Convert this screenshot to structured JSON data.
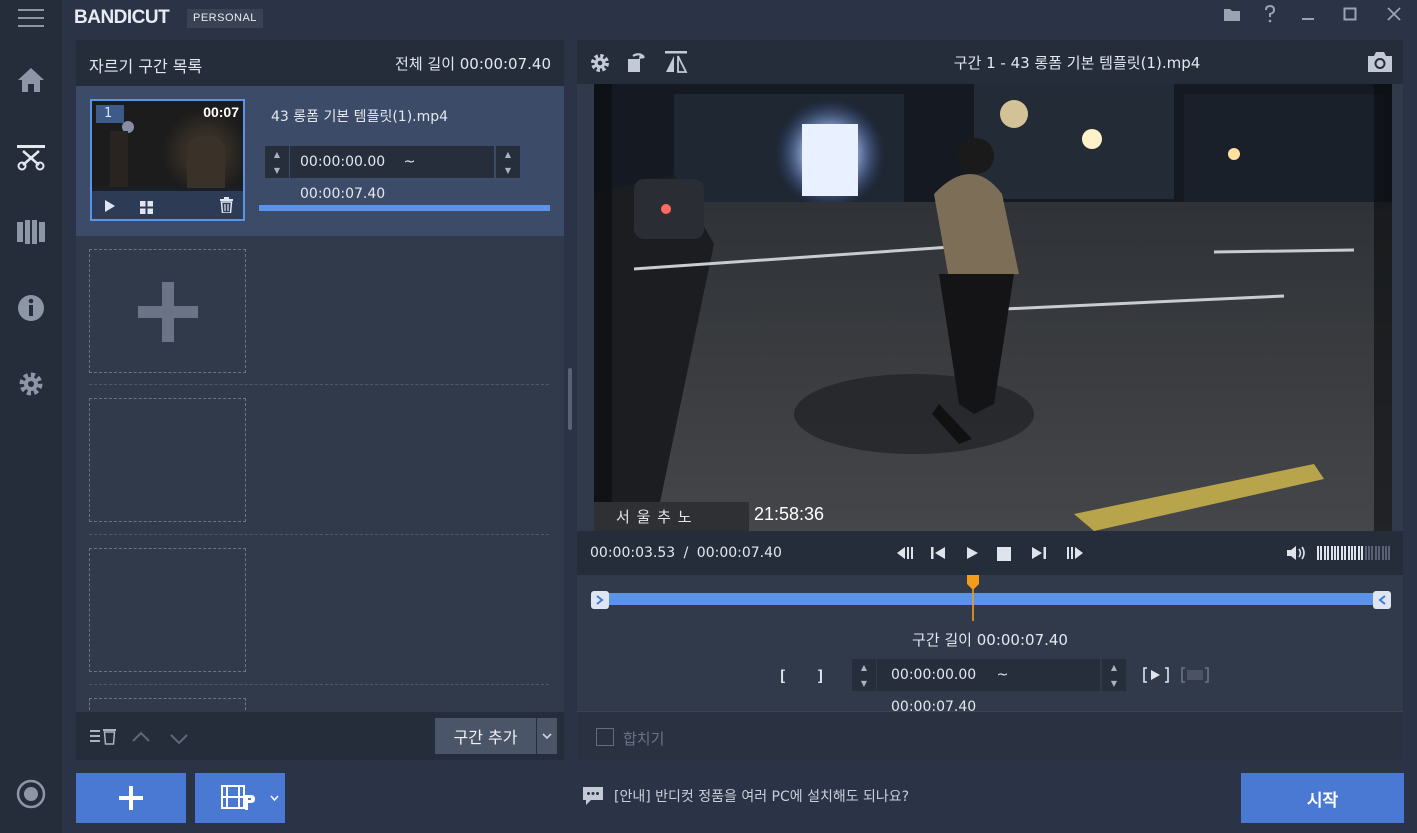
{
  "app": {
    "logo": "BANDICUT",
    "edition": "PERSONAL"
  },
  "segment_list": {
    "title": "자르기 구간 목록",
    "total_length": "전체 길이 00:00:07.40",
    "items": [
      {
        "index": "1",
        "duration": "00:07",
        "filename": "43 롱폼 기본 템플릿(1).mp4",
        "start": "00:00:00.00",
        "tilde": "~",
        "end": "00:00:07.40"
      }
    ],
    "add_segment_label": "구간 추가"
  },
  "player": {
    "title": "구간 1 - 43 롱폼 기본 템플릿(1).mp4",
    "overlay_location": "서 울 추 노",
    "overlay_time": "21:58:36",
    "current_time": "00:00:03.53",
    "separator": "/",
    "total_time": "00:00:07.40",
    "volume_level": 0.6,
    "playhead_fraction": 0.477
  },
  "timeline": {
    "segment_length": "구간 길이 00:00:07.40",
    "start": "00:00:00.00",
    "tilde": "~",
    "end": "00:00:07.40"
  },
  "merge": {
    "label": "합치기",
    "checked": false
  },
  "bottom": {
    "notice": "[안내] 반디컷 정품을 여러 PC에 설치해도 되나요?",
    "start_label": "시작"
  },
  "colors": {
    "accent": "#4979d2",
    "timeline_bar": "#5b93e8",
    "playhead": "#f59c1a"
  }
}
